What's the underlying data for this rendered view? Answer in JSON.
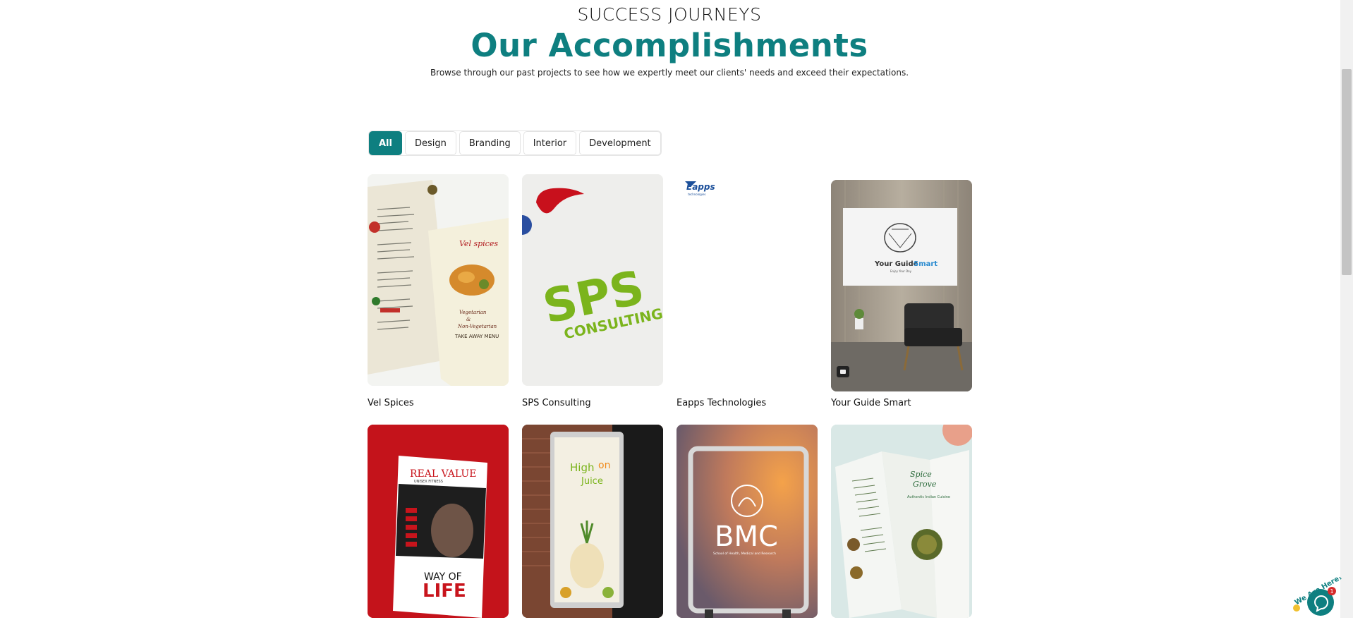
{
  "header": {
    "eyebrow": "SUCCESS JOURNEYS",
    "title": "Our Accomplishments",
    "subtitle": "Browse through our past projects to see how we expertly meet our clients' needs and exceed their expectations."
  },
  "filters": [
    {
      "label": "All",
      "active": true
    },
    {
      "label": "Design",
      "active": false
    },
    {
      "label": "Branding",
      "active": false
    },
    {
      "label": "Interior",
      "active": false
    },
    {
      "label": "Development",
      "active": false
    }
  ],
  "projects": [
    {
      "title": "Vel Spices",
      "art": {
        "brand": "Vel spices",
        "line1": "Vegetarian",
        "line2": "&",
        "line3": "Non-Vegetarian",
        "line4": "TAKE AWAY MENU"
      }
    },
    {
      "title": "SPS Consulting",
      "art": {
        "big": "SPS",
        "small": "CONSULTING"
      }
    },
    {
      "title": "Eapps Technologies",
      "art": {
        "logo": "Eapps",
        "sub": "technologies"
      }
    },
    {
      "title": "Your Guide Smart",
      "art": {
        "name_a": "Your Guide",
        "name_b": "Smart",
        "tag": "Enjoy Your Day"
      }
    },
    {
      "title": "",
      "art": {
        "brand": "REAL VALUE",
        "brand_sub": "UNISEX FITNESS",
        "way": "WAY OF",
        "life": "LIFE"
      }
    },
    {
      "title": "",
      "art": {
        "a": "High",
        "b": "on",
        "c": "Juice"
      }
    },
    {
      "title": "",
      "art": {
        "big": "BMC",
        "sub": "School of Health, Medical and Research"
      }
    },
    {
      "title": "",
      "art": {
        "a": "Spice",
        "b": "Grove",
        "c": "Authentic Indian Cuisine"
      }
    }
  ],
  "chat": {
    "label": "We Are Here!",
    "badge": "1"
  },
  "colors": {
    "accent": "#0e7f80",
    "sps_green": "#7bb41c",
    "fitness_red": "#c8141c"
  }
}
